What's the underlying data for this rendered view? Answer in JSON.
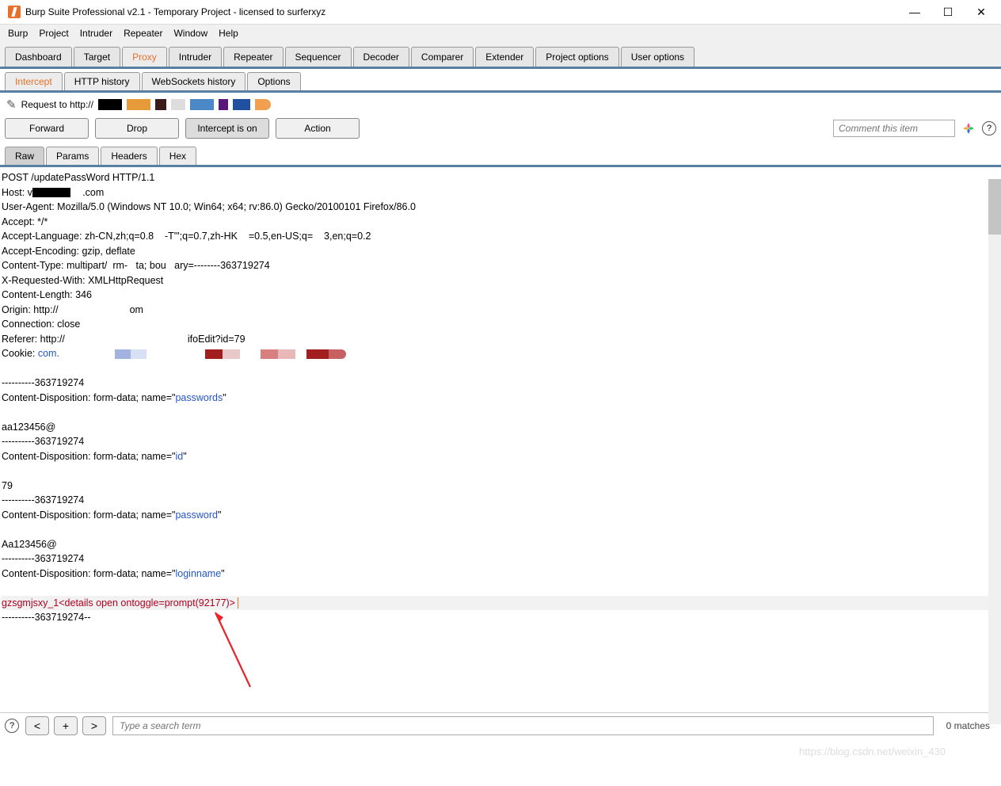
{
  "title": "Burp Suite Professional v2.1 - Temporary Project - licensed to surferxyz",
  "menu": [
    "Burp",
    "Project",
    "Intruder",
    "Repeater",
    "Window",
    "Help"
  ],
  "mainTabs": [
    "Dashboard",
    "Target",
    "Proxy",
    "Intruder",
    "Repeater",
    "Sequencer",
    "Decoder",
    "Comparer",
    "Extender",
    "Project options",
    "User options"
  ],
  "activeMainTab": "Proxy",
  "subTabs": [
    "Intercept",
    "HTTP history",
    "WebSockets history",
    "Options"
  ],
  "activeSubTab": "Intercept",
  "requestLabel": "Request to http://",
  "buttons": {
    "forward": "Forward",
    "drop": "Drop",
    "intercept": "Intercept is on",
    "action": "Action"
  },
  "commentPlaceholder": "Comment this item",
  "viewTabs": [
    "Raw",
    "Params",
    "Headers",
    "Hex"
  ],
  "activeViewTab": "Raw",
  "request": {
    "line1": "POST /updatePassWord HTTP/1.1",
    "hostPre": "Host: v",
    "hostPost": ".com",
    "userAgent": "User-Agent: Mozilla/5.0 (Windows NT 10.0; Win64; x64; rv:86.0) Gecko/20100101 Firefox/86.0",
    "accept": "Accept: */*",
    "acceptLang": "Accept-Language: zh-CN,zh;q=0.8    -T\"';q=0.7,zh-HK    =0.5,en-US;q=    3,en;q=0.2",
    "acceptEnc": "Accept-Encoding: gzip, deflate",
    "contentType": "Content-Type: multipart/  rm-   ta; bou   ary=--------363719274",
    "xrw": "X-Requested-With: XMLHttpRequest",
    "contentLen": "Content-Length: 346",
    "originPre": "Origin: http://",
    "originPost": "om",
    "connection": "Connection: close",
    "refererPre": "Referer: http://",
    "refererPost": "ifoEdit?id=79",
    "cookiePre": "Cookie: ",
    "cookieKw": "com.",
    "boundary1": "----------363719274",
    "cdPre": "Content-Disposition: form-data; name=\"",
    "cdQuote": "\"",
    "field1": "passwords",
    "value1": "aa123456@",
    "boundary2": "----------363719274",
    "field2": "id",
    "value2": "79",
    "boundary3": "----------363719274",
    "field3": "password",
    "value3": "Aa123456@",
    "boundary4": "----------363719274",
    "field4": "loginname",
    "value4": "gzsgmjsxy_1<details open ontoggle=prompt(92177)>",
    "boundaryEnd": "----------363719274--"
  },
  "searchPlaceholder": "Type a search term",
  "matches": "0 matches",
  "watermark": "https://blog.csdn.net/weixin_430"
}
